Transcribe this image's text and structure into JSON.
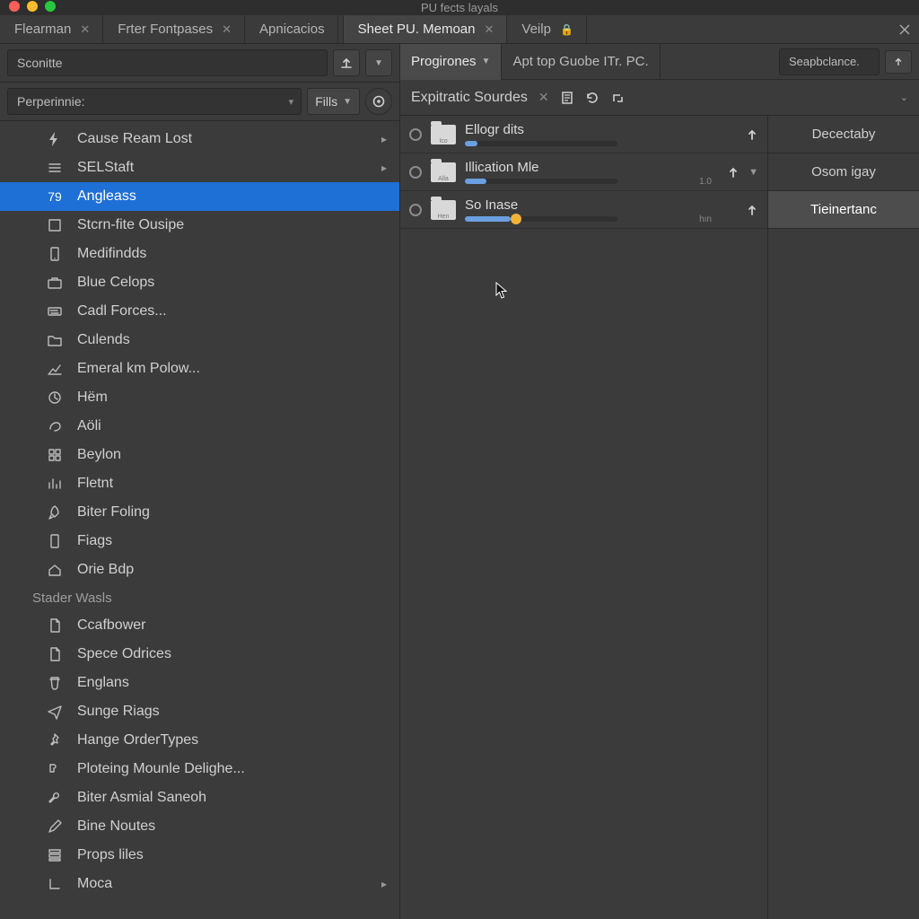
{
  "window": {
    "title": "PU fects layals"
  },
  "tabs": {
    "left": [
      {
        "label": "Flearman",
        "closable": true
      },
      {
        "label": "Frter Fontpases",
        "closable": true
      },
      {
        "label": "Apnicacios",
        "closable": false
      }
    ],
    "right": [
      {
        "label": "Sheet PU. Memoan",
        "closable": true,
        "active": true
      },
      {
        "label": "Veilp",
        "locked": true
      }
    ]
  },
  "left_toolbar": {
    "search_value": "Sconitte",
    "perperinie_label": "Perperinnie:",
    "fills_label": "Fills"
  },
  "tree": {
    "items": [
      {
        "icon": "bolt",
        "label": "Cause Ream Lost",
        "chev": true
      },
      {
        "icon": "stack",
        "label": "SELStaft",
        "chev": true
      },
      {
        "icon": "badge",
        "badge": "79",
        "label": "Angleass",
        "selected": true
      },
      {
        "icon": "square",
        "label": "Stcrn-fite Ousipe"
      },
      {
        "icon": "phone",
        "label": "Medifindds"
      },
      {
        "icon": "case",
        "label": "Blue Celops"
      },
      {
        "icon": "keys",
        "label": "Cadl Forces..."
      },
      {
        "icon": "folder",
        "label": "Culends"
      },
      {
        "icon": "chart",
        "label": "Emeral km Polow..."
      },
      {
        "icon": "clock",
        "label": "Hëm"
      },
      {
        "icon": "swirl",
        "label": "Aöli"
      },
      {
        "icon": "grid",
        "label": "Beylon"
      },
      {
        "icon": "bars",
        "label": "Fletnt"
      },
      {
        "icon": "rocket",
        "label": "Biter Foling"
      },
      {
        "icon": "phone2",
        "label": "Fiags"
      },
      {
        "icon": "home",
        "label": "Orie Bdp"
      },
      {
        "group": true,
        "label": "Stader Wasls"
      },
      {
        "icon": "doc",
        "label": "Ccafbower"
      },
      {
        "icon": "doc",
        "label": "Spece Odrices"
      },
      {
        "icon": "cup",
        "label": "Englans"
      },
      {
        "icon": "send",
        "label": "Sunge Riags"
      },
      {
        "icon": "pin",
        "label": "Hange OrderTypes"
      },
      {
        "icon": "puzzle",
        "label": "Ploteing Mounle Delighe..."
      },
      {
        "icon": "wrench",
        "label": "Biter Asmial Saneoh"
      },
      {
        "icon": "pen",
        "label": "Bine Noutes"
      },
      {
        "icon": "stack2",
        "label": "Props liles"
      },
      {
        "icon": "corner",
        "label": "Moca",
        "chev": true
      }
    ]
  },
  "right_panel": {
    "tabbar": {
      "tabs": [
        {
          "label": "Progirones",
          "active": true,
          "dropdown": true
        },
        {
          "label": "Apt top Guobe ITr. PC."
        }
      ],
      "search_placeholder": "Seapbclance."
    },
    "panel_title": "Expitratic Sourdes",
    "rows": [
      {
        "folder_tag": "Ico",
        "label": "Ellogr dits",
        "progress": 8,
        "knob": null,
        "tiny": "",
        "up": true,
        "dd": false
      },
      {
        "folder_tag": "Alla",
        "label": "Illication Mle",
        "progress": 14,
        "knob": null,
        "tiny": "1.0",
        "up": true,
        "dd": true
      },
      {
        "folder_tag": "Hen",
        "label": "So Inase",
        "progress": 30,
        "knob": 30,
        "tiny": "hın",
        "up": true,
        "dd": false
      }
    ],
    "side": [
      {
        "label": "Decectaby"
      },
      {
        "label": "Osom igay"
      },
      {
        "label": "Tieinertanc",
        "active": true
      }
    ]
  }
}
